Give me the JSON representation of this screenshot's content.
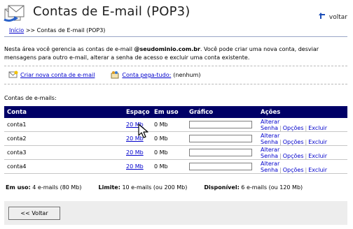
{
  "header": {
    "title": "Contas de E-mail (POP3)",
    "back_label": "voltar"
  },
  "breadcrumb": {
    "home": "Início",
    "separator": " >> ",
    "current": "Contas de E-mail (POP3)"
  },
  "intro": {
    "line1_a": "Nesta área você gerencia as contas de e-mail ",
    "domain": "@seudominio.com.br",
    "line1_b": ". Você pode criar uma nova conta, desviar",
    "line2": "mensagens para outro e-mail, alterar a senha de acesso e excluir uma conta existente."
  },
  "actions": {
    "create_label": "Criar nova conta de e-mail",
    "catchall_label": "Conta pega-tudo:",
    "catchall_value": " (nenhum)"
  },
  "list_title": "Contas de e-mails:",
  "table": {
    "headers": [
      "Conta",
      "Espaço",
      "Em uso",
      "Gráfico",
      "Ações"
    ],
    "rows": [
      {
        "account": "conta1",
        "space": "20 Mb",
        "used": "0 Mb",
        "usage_fraction": 0
      },
      {
        "account": "conta2",
        "space": "20 Mb",
        "used": "0 Mb",
        "usage_fraction": 0
      },
      {
        "account": "conta3",
        "space": "20 Mb",
        "used": "0 Mb",
        "usage_fraction": 0
      },
      {
        "account": "conta4",
        "space": "20 Mb",
        "used": "0 Mb",
        "usage_fraction": 0
      }
    ],
    "action_labels": {
      "change_password": "Alterar Senha",
      "options": "Opções",
      "delete": "Excluir",
      "separator": "|"
    }
  },
  "summary": {
    "in_use_label": "Em uso:",
    "in_use_value": " 4 e-mails (80 Mb)",
    "limit_label": "Limite:",
    "limit_value": " 10 e-mails (ou 200 Mb)",
    "available_label": "Disponível:",
    "available_value": " 6 e-mails (ou 120 Mb)"
  },
  "footer": {
    "back_button": "<< Voltar"
  },
  "colors": {
    "table_header_bg": "#000066",
    "link": "#0000cc",
    "footer_bg": "#ededed"
  },
  "icons": {
    "logo": "mail-accounts-icon",
    "back": "return-arrow-icon",
    "create": "new-mail-icon",
    "catchall": "catchall-icon",
    "cursor": "mouse-pointer-icon"
  }
}
